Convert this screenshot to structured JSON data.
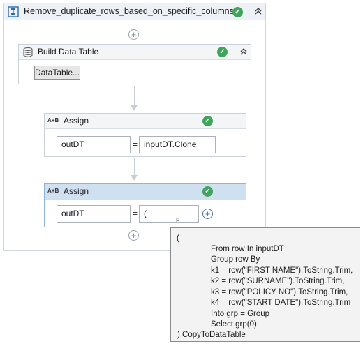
{
  "sequence": {
    "title": "Remove_duplicate_rows_based_on_specific_columns",
    "status_icon": "check-circle",
    "collapse_icon": "double-chevron-up"
  },
  "build_data_table": {
    "title": "Build Data Table",
    "icon": "table-icon",
    "button_label": "DataTable..."
  },
  "assign1": {
    "title": "Assign",
    "icon_label": "A+B",
    "to_value": "outDT",
    "equals": "=",
    "value": "inputDT.Clone"
  },
  "assign2": {
    "title": "Assign",
    "icon_label": "A+B",
    "to_value": "outDT",
    "equals": "=",
    "value": "(",
    "value_overflow": "F"
  },
  "tooltip": {
    "lines": [
      "(",
      "From row In inputDT",
      "Group row By",
      "k1 = row(\"FIRST NAME\").ToString.Trim,",
      "k2 = row(\"SURNAME\").ToString.Trim,",
      "k3 = row(\"POLICY NO\").ToString.Trim,",
      "k4 = row(\"START DATE\").ToString.Trim",
      "Into grp = Group",
      "Select grp(0)",
      ").CopyToDataTable"
    ]
  },
  "colors": {
    "success": "#3ea55a",
    "selected_header": "#cfe0f1",
    "header": "#eef2f6"
  }
}
